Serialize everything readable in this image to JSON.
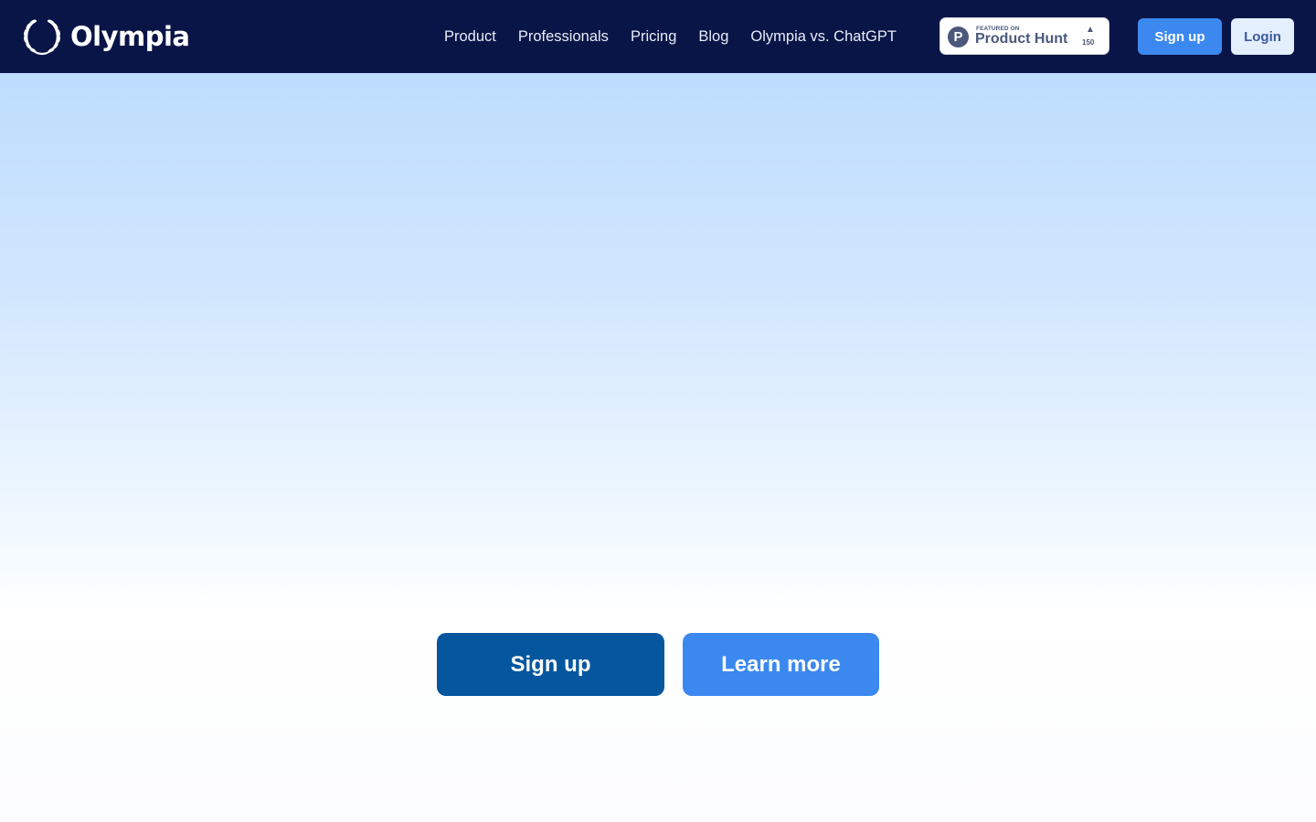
{
  "header": {
    "brand": "Olympia",
    "logo_icon": "laurel-wreath-icon",
    "nav": [
      {
        "label": "Product"
      },
      {
        "label": "Professionals"
      },
      {
        "label": "Pricing"
      },
      {
        "label": "Blog"
      },
      {
        "label": "Olympia vs. ChatGPT"
      }
    ],
    "product_hunt": {
      "logo_letter": "P",
      "featured_label": "FEATURED ON",
      "name": "Product Hunt",
      "arrow": "▲",
      "upvotes": "150"
    },
    "signup_label": "Sign up",
    "login_label": "Login"
  },
  "hero": {
    "primary_cta": "Sign up",
    "secondary_cta": "Learn more"
  },
  "colors": {
    "nav_bg": "#0a1547",
    "accent": "#3b89f0",
    "primary_cta": "#04579f",
    "login_bg": "#e3effd",
    "hero_top": "#bddcfd"
  }
}
